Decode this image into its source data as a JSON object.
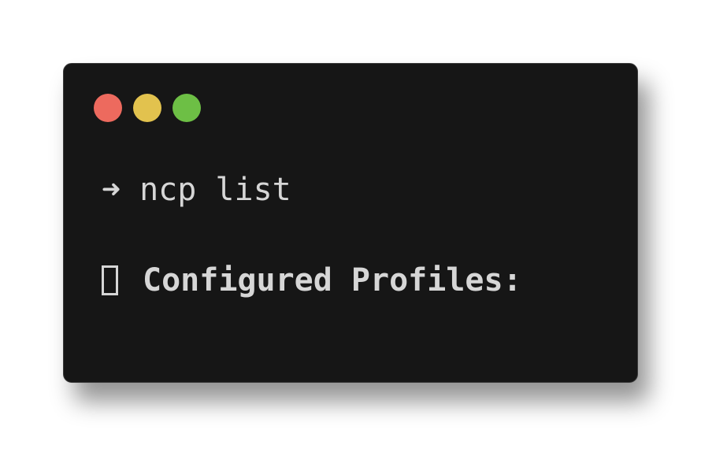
{
  "window": {
    "controls": [
      {
        "name": "close",
        "color": "#ed6a5e"
      },
      {
        "name": "minimize",
        "color": "#e2c24e"
      },
      {
        "name": "maximize",
        "color": "#6dbf45"
      }
    ]
  },
  "terminal": {
    "prompt_symbol": "➜",
    "command": "ncp list",
    "output": {
      "icon": "missing-glyph-box",
      "text": "Configured Profiles:"
    }
  },
  "colors": {
    "terminal_background": "#161616",
    "text": "#d6d6d6"
  }
}
